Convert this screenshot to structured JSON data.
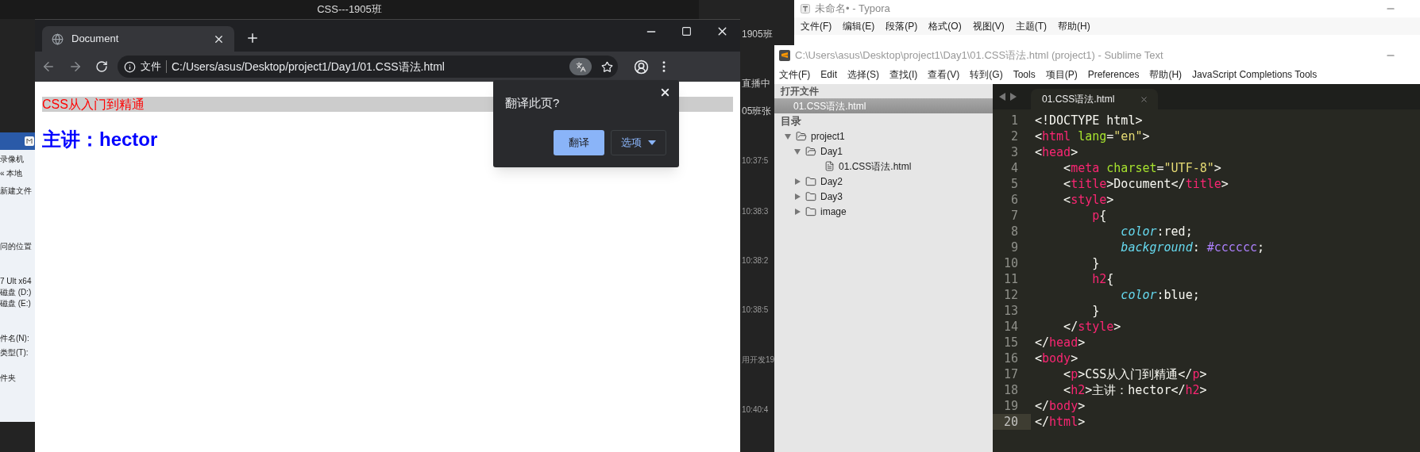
{
  "background_window": {
    "title": "CSS---1905班",
    "chat": [
      "1905班",
      "直播中",
      "05班张",
      "10:37:5",
      "10:38:3",
      "10:38:2",
      "10:38:5",
      "用开发19",
      "10:40:4"
    ]
  },
  "explorer_fragment": {
    "items": [
      "录像机",
      "« 本地",
      "新建文件",
      "问的位置",
      "7 Ult x64",
      "磁盘 (D:)",
      "磁盘 (E:)",
      "件名(N):",
      "类型(T):",
      "件夹"
    ]
  },
  "browser": {
    "tab": {
      "title": "Document"
    },
    "address": {
      "scheme": "文件",
      "url": "C:/Users/asus/Desktop/project1/Day1/01.CSS语法.html"
    },
    "page": {
      "paragraph": "CSS从入门到精通",
      "heading": "主讲：hector"
    },
    "translate_popup": {
      "title": "翻译此页?",
      "buttons": [
        {
          "label": "翻译",
          "kind": "primary"
        },
        {
          "label": "选项",
          "kind": "menu"
        }
      ]
    }
  },
  "typora": {
    "title": "未命名• - Typora",
    "menu": [
      "文件(F)",
      "编辑(E)",
      "段落(P)",
      "格式(O)",
      "视图(V)",
      "主题(T)",
      "帮助(H)"
    ]
  },
  "sublime": {
    "title": "C:\\Users\\asus\\Desktop\\project1\\Day1\\01.CSS语法.html (project1) - Sublime Text",
    "menu": [
      "文件(F)",
      "Edit",
      "选择(S)",
      "查找(I)",
      "查看(V)",
      "转到(G)",
      "Tools",
      "项目(P)",
      "Preferences",
      "帮助(H)",
      "JavaScript Completions Tools"
    ],
    "sidebar": {
      "open_files_header": "打开文件",
      "open_files": [
        {
          "name": "01.CSS语法.html",
          "selected": true
        }
      ],
      "folders_header": "目录",
      "tree": [
        {
          "name": "project1",
          "kind": "folder",
          "expanded": true,
          "children": [
            {
              "name": "Day1",
              "kind": "folder",
              "expanded": true,
              "children": [
                {
                  "name": "01.CSS语法.html",
                  "kind": "file"
                }
              ]
            },
            {
              "name": "Day2",
              "kind": "folder",
              "expanded": false
            },
            {
              "name": "Day3",
              "kind": "folder",
              "expanded": false
            },
            {
              "name": "image",
              "kind": "folder",
              "expanded": false
            }
          ]
        }
      ]
    },
    "tab": {
      "title": "01.CSS语法.html"
    },
    "lines": [
      {
        "number": "1",
        "current": false,
        "tokens": [
          {
            "kind": "punct",
            "text": "<!DOCTYPE html>"
          }
        ]
      },
      {
        "number": "2",
        "current": false,
        "tokens": [
          {
            "kind": "punct",
            "text": "<"
          },
          {
            "kind": "tag",
            "text": "html"
          },
          {
            "kind": "attr",
            "text": " lang"
          },
          {
            "kind": "punct",
            "text": "="
          },
          {
            "kind": "string",
            "text": "\"en\""
          },
          {
            "kind": "punct",
            "text": ">"
          }
        ]
      },
      {
        "number": "3",
        "current": false,
        "tokens": [
          {
            "kind": "punct",
            "text": "<"
          },
          {
            "kind": "tag",
            "text": "head"
          },
          {
            "kind": "punct",
            "text": ">"
          }
        ]
      },
      {
        "number": "4",
        "current": false,
        "tokens": [
          {
            "kind": "punct",
            "text": "    <"
          },
          {
            "kind": "tag",
            "text": "meta"
          },
          {
            "kind": "attr",
            "text": " charset"
          },
          {
            "kind": "punct",
            "text": "="
          },
          {
            "kind": "string",
            "text": "\"UTF-8\""
          },
          {
            "kind": "punct",
            "text": ">"
          }
        ]
      },
      {
        "number": "5",
        "current": false,
        "tokens": [
          {
            "kind": "punct",
            "text": "    <"
          },
          {
            "kind": "tag",
            "text": "title"
          },
          {
            "kind": "punct",
            "text": ">Document</"
          },
          {
            "kind": "tag",
            "text": "title"
          },
          {
            "kind": "punct",
            "text": ">"
          }
        ]
      },
      {
        "number": "6",
        "current": false,
        "tokens": [
          {
            "kind": "punct",
            "text": "    <"
          },
          {
            "kind": "tag",
            "text": "style"
          },
          {
            "kind": "punct",
            "text": ">"
          }
        ]
      },
      {
        "number": "7",
        "current": false,
        "tokens": [
          {
            "kind": "tag",
            "text": "        p"
          },
          {
            "kind": "punct",
            "text": "{"
          }
        ]
      },
      {
        "number": "8",
        "current": false,
        "tokens": [
          {
            "kind": "property",
            "text": "            color"
          },
          {
            "kind": "punct",
            "text": ":red;"
          }
        ]
      },
      {
        "number": "9",
        "current": false,
        "tokens": [
          {
            "kind": "property",
            "text": "            background"
          },
          {
            "kind": "punct",
            "text": ": "
          },
          {
            "kind": "number",
            "text": "#cccccc"
          },
          {
            "kind": "punct",
            "text": ";"
          }
        ]
      },
      {
        "number": "10",
        "current": false,
        "tokens": [
          {
            "kind": "punct",
            "text": "        }"
          }
        ]
      },
      {
        "number": "11",
        "current": false,
        "tokens": [
          {
            "kind": "tag",
            "text": "        h2"
          },
          {
            "kind": "punct",
            "text": "{"
          }
        ]
      },
      {
        "number": "12",
        "current": false,
        "tokens": [
          {
            "kind": "property",
            "text": "            color"
          },
          {
            "kind": "punct",
            "text": ":blue;"
          }
        ]
      },
      {
        "number": "13",
        "current": false,
        "tokens": [
          {
            "kind": "punct",
            "text": "        }"
          }
        ]
      },
      {
        "number": "14",
        "current": false,
        "tokens": [
          {
            "kind": "punct",
            "text": "    </"
          },
          {
            "kind": "tag",
            "text": "style"
          },
          {
            "kind": "punct",
            "text": ">"
          }
        ]
      },
      {
        "number": "15",
        "current": false,
        "tokens": [
          {
            "kind": "punct",
            "text": "</"
          },
          {
            "kind": "tag",
            "text": "head"
          },
          {
            "kind": "punct",
            "text": ">"
          }
        ]
      },
      {
        "number": "16",
        "current": false,
        "tokens": [
          {
            "kind": "punct",
            "text": "<"
          },
          {
            "kind": "tag",
            "text": "body"
          },
          {
            "kind": "punct",
            "text": ">"
          }
        ]
      },
      {
        "number": "17",
        "current": false,
        "tokens": [
          {
            "kind": "punct",
            "text": "    <"
          },
          {
            "kind": "tag",
            "text": "p"
          },
          {
            "kind": "punct",
            "text": ">CSS从入门到精通</"
          },
          {
            "kind": "tag",
            "text": "p"
          },
          {
            "kind": "punct",
            "text": ">"
          }
        ]
      },
      {
        "number": "18",
        "current": false,
        "tokens": [
          {
            "kind": "punct",
            "text": "    <"
          },
          {
            "kind": "tag",
            "text": "h2"
          },
          {
            "kind": "punct",
            "text": ">主讲：hector</"
          },
          {
            "kind": "tag",
            "text": "h2"
          },
          {
            "kind": "punct",
            "text": ">"
          }
        ]
      },
      {
        "number": "19",
        "current": false,
        "tokens": [
          {
            "kind": "punct",
            "text": "</"
          },
          {
            "kind": "tag",
            "text": "body"
          },
          {
            "kind": "punct",
            "text": ">"
          }
        ]
      },
      {
        "number": "20",
        "current": true,
        "tokens": [
          {
            "kind": "punct",
            "text": "</"
          },
          {
            "kind": "tag",
            "text": "html"
          },
          {
            "kind": "punct",
            "text": ">"
          }
        ]
      }
    ]
  }
}
